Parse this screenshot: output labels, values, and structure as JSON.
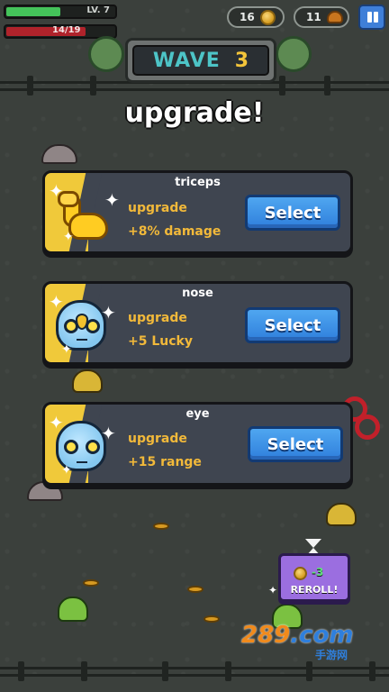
{
  "hud": {
    "level_label": "LV. 7",
    "xp_fraction": 0.5,
    "hp_text": "14/19",
    "hp_fraction": 0.737,
    "coins": "16",
    "kills": "11"
  },
  "wave": {
    "label": "WAVE",
    "number": "3"
  },
  "title": "upgrade!",
  "cards": [
    {
      "name": "triceps",
      "line1": "upgrade",
      "line2": "+8% damage",
      "icon": "muscle-arm-icon",
      "select_label": "Select"
    },
    {
      "name": "nose",
      "line1": "upgrade",
      "line2": "+5 Lucky",
      "icon": "mask-icon",
      "select_label": "Select"
    },
    {
      "name": "eye",
      "line1": "upgrade",
      "line2": "+15 range",
      "icon": "mask-icon",
      "select_label": "Select"
    }
  ],
  "reroll": {
    "cost": "-3",
    "label": "REROLL!"
  },
  "watermark": {
    "main_a": "289",
    "main_b": ".com",
    "sub": "手游网"
  },
  "colors": {
    "select_blue": "#2f7fdc",
    "upgrade_text": "#f2b93a",
    "card_bg": "#3f4550",
    "card_stripe": "#f0c93a",
    "wave_text": "#4dc4c7",
    "wave_number": "#f3c43a",
    "hp_red": "#b0232b",
    "xp_green": "#44c35a",
    "reroll_purple": "#9b6ee0"
  }
}
